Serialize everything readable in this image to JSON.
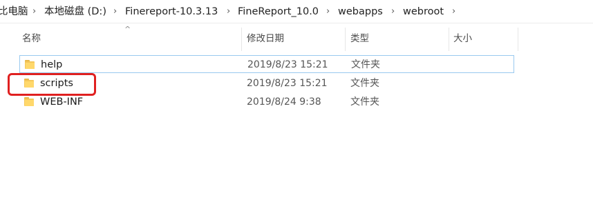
{
  "breadcrumb": {
    "items": [
      "比电脑",
      "本地磁盘 (D:)",
      "Finereport-10.3.13",
      "FineReport_10.0",
      "webapps",
      "webroot"
    ],
    "separator": "›"
  },
  "columns": {
    "name": "名称",
    "date": "修改日期",
    "type": "类型",
    "size": "大小",
    "sort_indicator": "^"
  },
  "rows": [
    {
      "name": "help",
      "date": "2019/8/23 15:21",
      "type": "文件夹",
      "icon": "folder-icon"
    },
    {
      "name": "scripts",
      "date": "2019/8/23 15:21",
      "type": "文件夹",
      "icon": "folder-icon"
    },
    {
      "name": "WEB-INF",
      "date": "2019/8/24 9:38",
      "type": "文件夹",
      "icon": "folder-icon"
    }
  ],
  "colors": {
    "selection_border": "#99c9ef",
    "annotation": "#e02020",
    "folder": "#f5c75a"
  }
}
